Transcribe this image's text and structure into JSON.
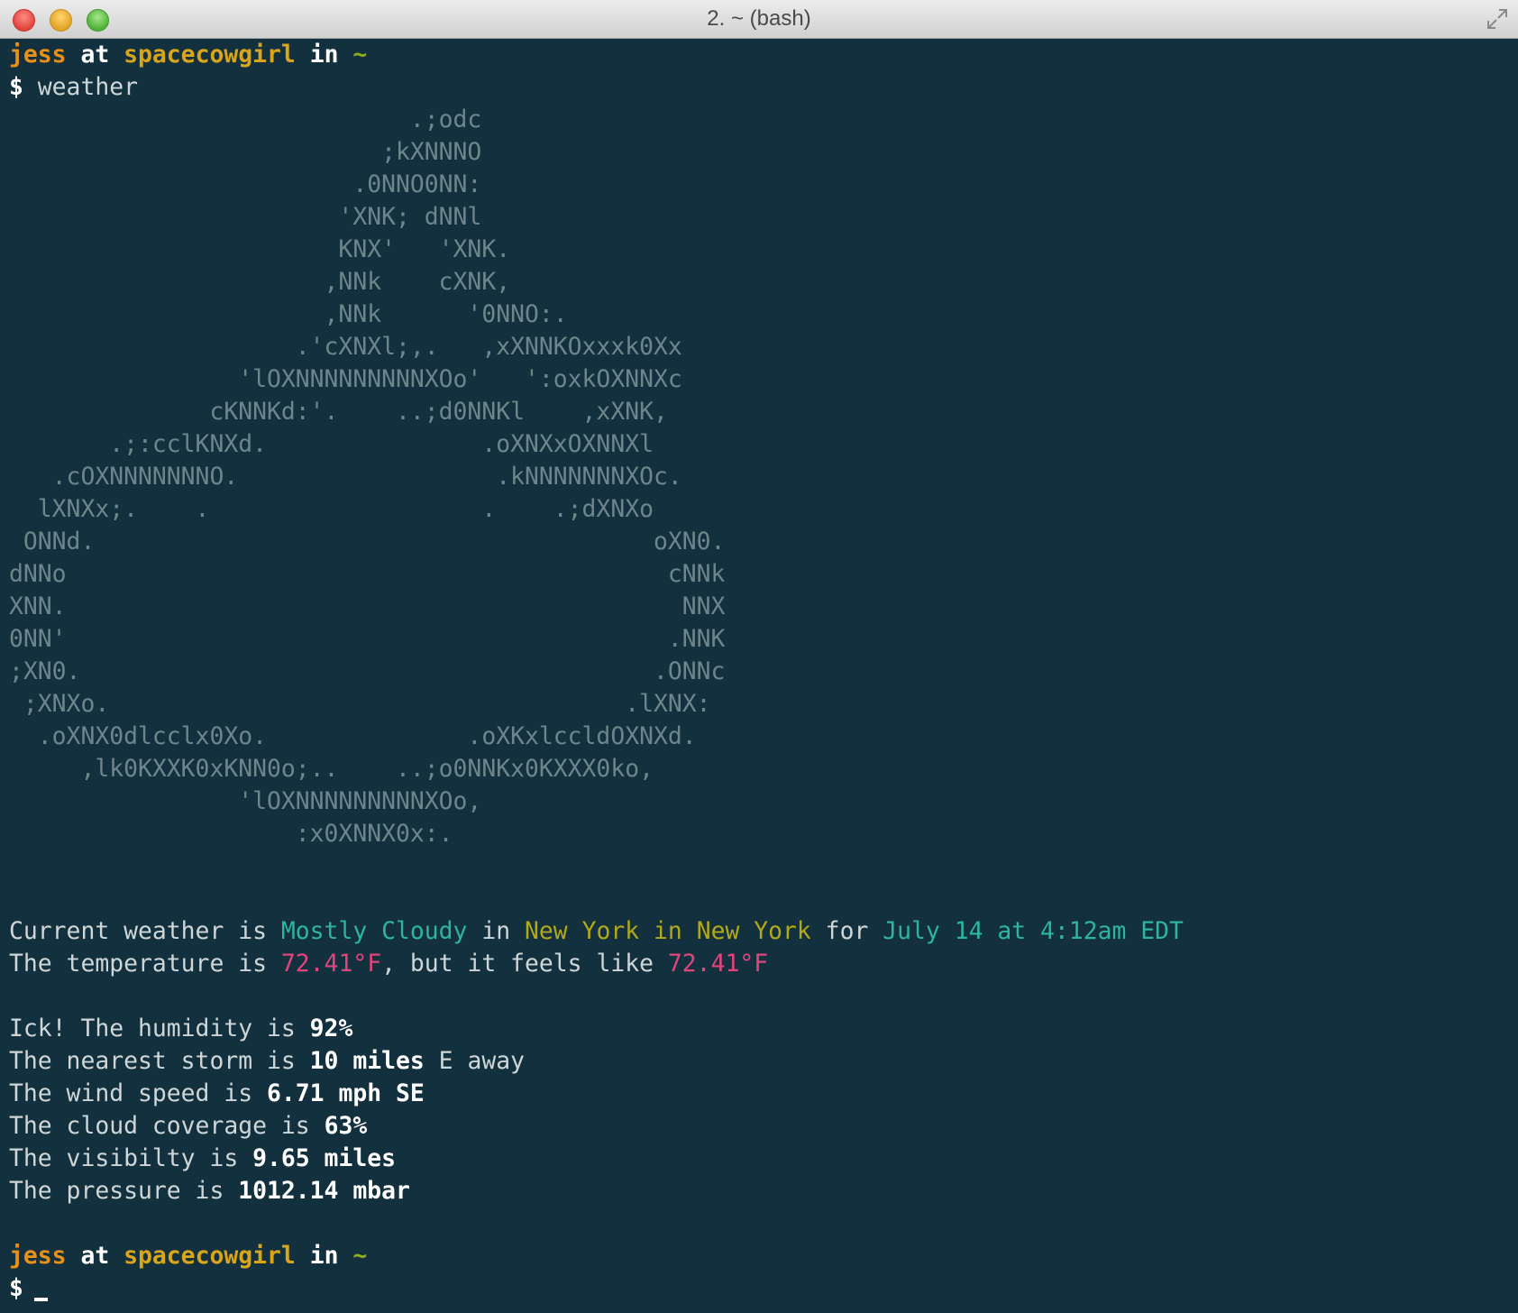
{
  "window": {
    "title": "2. ~ (bash)"
  },
  "prompt": {
    "user": "jess",
    "at": "at",
    "host": "spacecowgirl",
    "in": "in",
    "dir": "~",
    "symbol": "$",
    "command": "weather"
  },
  "ascii_art": [
    "                            .;odc",
    "                          ;kXNNNO",
    "                        .0NNO0NN:",
    "                       'XNK; dNNl",
    "                       KNX'   'XNK.",
    "                      ,NNk    cXNK,",
    "                      ,NNk      '0NNO:.",
    "                    .'cXNXl;,.   ,xXNNKOxxxk0Xx",
    "                'lOXNNNNNNNNNXOo'   ':oxkOXNNXc",
    "              cKNNKd:'.    ..;d0NNKl    ,xXNK,",
    "       .;:cclKNXd.               .oXNXxOXNNXl",
    "   .cOXNNNNNNNO.                  .kNNNNNNNXOc.",
    "  lXNXx;.    .                   .    .;dXNXo",
    " ONNd.                                       oXN0.",
    "dNNo                                          cNNk",
    "XNN.                                           NNX",
    "0NN'                                          .NNK",
    ";XN0.                                        .ONNc",
    " ;XNXo.                                    .lXNX:",
    "  .oXNX0dlcclx0Xo.              .oXKxlccldOXNXd.",
    "     ,lk0KXXK0xKNN0o;..    ..;o0NNKx0KXXX0ko,",
    "                'lOXNNNNNNNNNXOo,",
    "                    :x0XNNX0x:."
  ],
  "weather": {
    "line1": {
      "prefix": "Current weather is ",
      "condition": "Mostly Cloudy",
      "in1": " in ",
      "city": "New York",
      "in2": " in ",
      "region": "New York",
      "for": " for ",
      "time": "July 14 at 4:12am EDT"
    },
    "line2": {
      "prefix": "The temperature is ",
      "temp": "72.41°F",
      "mid": ", but it feels like ",
      "feels": "72.41°F"
    },
    "humidity": {
      "prefix": "Ick! The humidity is ",
      "value": "92%"
    },
    "storm": {
      "prefix": "The nearest storm is ",
      "value": "10 miles",
      "dir": " E",
      "suffix": " away"
    },
    "wind": {
      "prefix": "The wind speed is ",
      "value": "6.71 mph SE"
    },
    "cloud": {
      "prefix": "The cloud coverage is ",
      "value": "63%"
    },
    "visibility": {
      "prefix": "The visibilty is ",
      "value": "9.65 miles"
    },
    "pressure": {
      "prefix": "The pressure is ",
      "value": "1012.14 mbar"
    }
  },
  "colors": {
    "background": "#12303d",
    "user": "#e7911b",
    "host": "#d9a51b",
    "dir": "#8fae1d",
    "condition": "#2fb3a3",
    "location": "#b2a81b",
    "temperature": "#e0457b",
    "art": "#6f858c"
  }
}
